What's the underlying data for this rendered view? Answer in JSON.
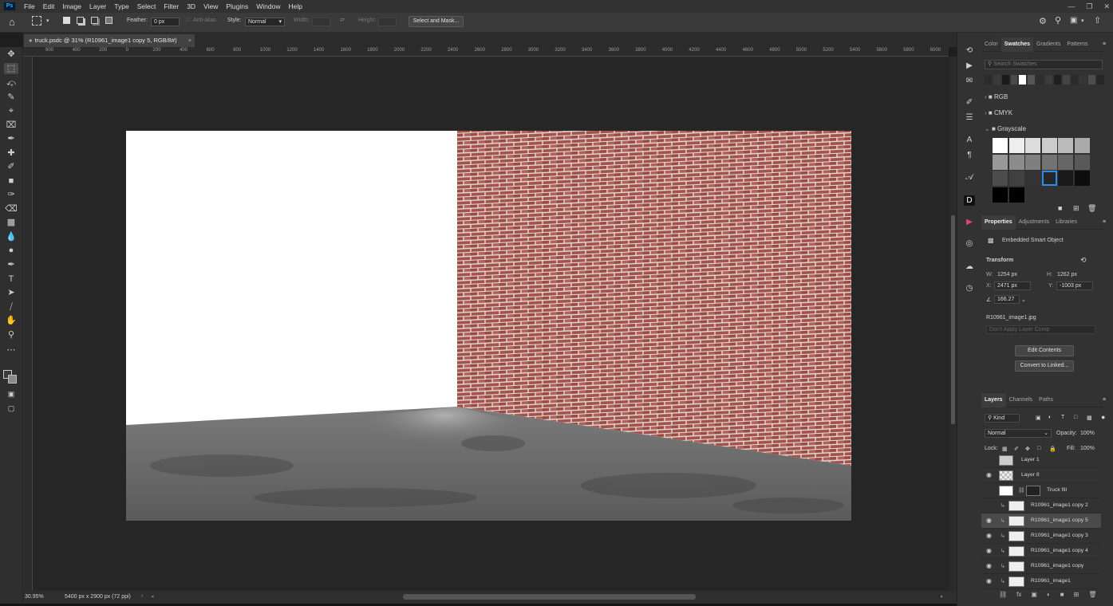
{
  "menu": {
    "items": [
      "File",
      "Edit",
      "Image",
      "Layer",
      "Type",
      "Select",
      "Filter",
      "3D",
      "View",
      "Plugins",
      "Window",
      "Help"
    ]
  },
  "options": {
    "feather_label": "Feather:",
    "feather_value": "0 px",
    "antialias_label": "Anti-alias",
    "style_label": "Style:",
    "style_value": "Normal",
    "width_label": "Width:",
    "height_label": "Height:",
    "select_mask_label": "Select and Mask..."
  },
  "document": {
    "tab_title": "truck.psdc @ 31% (R10961_image1 copy 5, RGB/8#)",
    "close": "×"
  },
  "ruler": {
    "h_ticks": [
      "600",
      "400",
      "200",
      "0",
      "200",
      "400",
      "600",
      "800",
      "1000",
      "1200",
      "1400",
      "1600",
      "1800",
      "2000",
      "2200",
      "2400",
      "2600",
      "2800",
      "3000",
      "3200",
      "3400",
      "3600",
      "3800",
      "4000",
      "4200",
      "4400",
      "4600",
      "4800",
      "5000",
      "5200",
      "5400",
      "5600",
      "5800",
      "6000"
    ]
  },
  "status": {
    "zoom": "30.95%",
    "doc_info": "5400 px x 2900 px (72 ppi)"
  },
  "swatches": {
    "tabs": [
      "Color",
      "Swatches",
      "Gradients",
      "Patterns"
    ],
    "active_tab": "Swatches",
    "search_placeholder": "Search Swatches",
    "recent": [
      "#2b2b2b",
      "#3a3a3a",
      "#1a1a1a",
      "#4a4a4a",
      "#ffffff",
      "#555555",
      "#2f2f2f",
      "#3c3c3c",
      "#1f1f1f",
      "#444444",
      "#2a2a2a",
      "#363636",
      "#4d4d4d",
      "#262626"
    ],
    "folders": [
      "RGB",
      "CMYK",
      "Grayscale"
    ],
    "grayscale": [
      "#ffffff",
      "#eeeeee",
      "#dddddd",
      "#cccccc",
      "#bbbbbb",
      "#aaaaaa",
      "#999999",
      "#8c8c8c",
      "#7f7f7f",
      "#737373",
      "#666666",
      "#595959",
      "#4c4c4c",
      "#404040",
      "#333333",
      "#262626",
      "#1a1a1a",
      "#0d0d0d",
      "#000000",
      "#000000"
    ]
  },
  "properties": {
    "tabs": [
      "Properties",
      "Adjustments",
      "Libraries"
    ],
    "active_tab": "Properties",
    "type": "Embedded Smart Object",
    "section": "Transform",
    "w_label": "W:",
    "w_value": "1254 px",
    "h_label": "H:",
    "h_value": "1262 px",
    "x_label": "X:",
    "x_value": "2471 px",
    "y_label": "Y:",
    "y_value": "-1003 px",
    "angle_value": "166.27",
    "filename": "R10961_image1.jpg",
    "layer_comp": "Don't Apply Layer Comp",
    "edit_contents": "Edit Contents",
    "convert_linked": "Convert to Linked..."
  },
  "layers": {
    "tabs": [
      "Layers",
      "Channels",
      "Paths"
    ],
    "active_tab": "Layers",
    "kind": "Kind",
    "blend": "Normal",
    "opacity_label": "Opacity:",
    "opacity_value": "100%",
    "lock_label": "Lock:",
    "fill_label": "Fill:",
    "fill_value": "100%",
    "items": [
      {
        "name": "Layer 1",
        "visible": false
      },
      {
        "name": "Layer 8",
        "visible": true
      },
      {
        "name": "Truck fill",
        "visible": false
      },
      {
        "name": "R10961_image1 copy 2",
        "visible": false
      },
      {
        "name": "R10961_image1 copy 5",
        "visible": true
      },
      {
        "name": "R10961_image1 copy 3",
        "visible": true
      },
      {
        "name": "R10961_image1 copy 4",
        "visible": true
      },
      {
        "name": "R10961_image1 copy",
        "visible": true
      },
      {
        "name": "R10961_image1",
        "visible": true
      }
    ]
  }
}
